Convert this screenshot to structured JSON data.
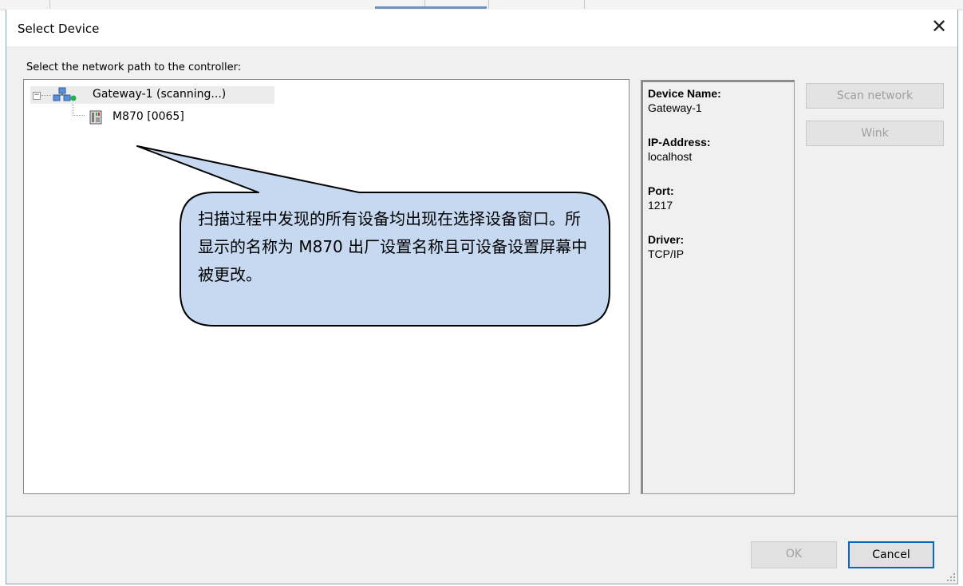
{
  "dialog": {
    "title": "Select Device",
    "close_glyph": "✕",
    "prompt": "Select the network path to the controller:"
  },
  "tree": {
    "expander_glyph": "−",
    "gateway": {
      "label": "Gateway-1 (scanning...)",
      "icon": "network-gateway-icon",
      "status_color": "#22b14c"
    },
    "device": {
      "label": "M870 [0065]",
      "icon": "controller-device-icon"
    }
  },
  "info": {
    "device_name_label": "Device Name:",
    "device_name": "Gateway-1",
    "ip_label": "IP-Address:",
    "ip": "localhost",
    "port_label": "Port:",
    "port": "1217",
    "driver_label": "Driver:",
    "driver": "TCP/IP"
  },
  "buttons": {
    "scan": "Scan network",
    "wink": "Wink",
    "ok": "OK",
    "cancel": "Cancel"
  },
  "callout": {
    "text": "扫描过程中发现的所有设备均出现在选择设备窗口。所显示的名称为 M870 出厂设置名称且可设备设置屏幕中被更改。",
    "fill": "#c6d9f1",
    "stroke": "#000000"
  },
  "colors": {
    "accent": "#0a67c4"
  }
}
